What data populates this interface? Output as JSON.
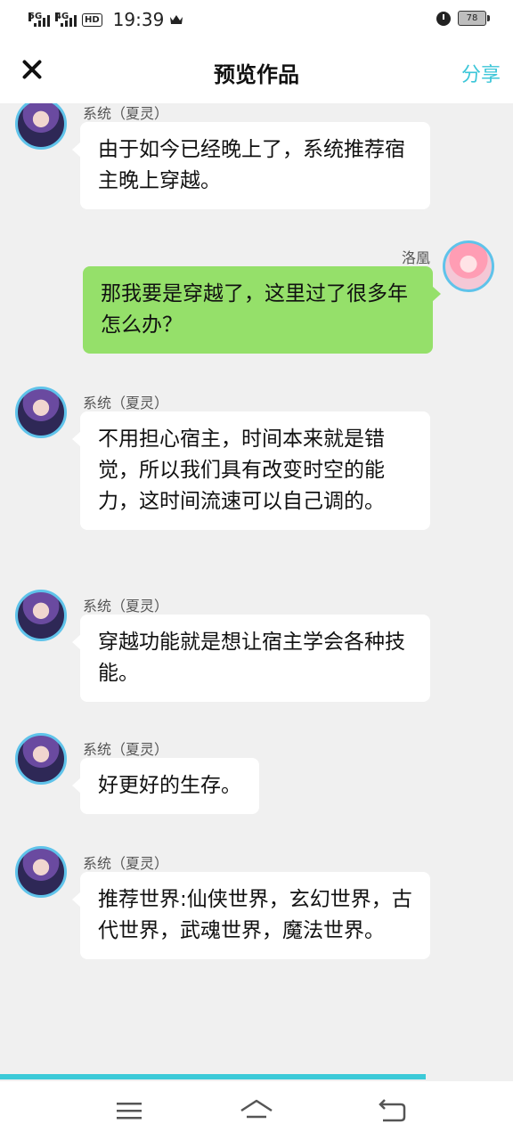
{
  "status_bar": {
    "signal1_label": "5G",
    "signal2_label": "4G",
    "hd_label": "HD",
    "time": "19:39",
    "battery": "78",
    "icons": [
      "crown-icon",
      "alarm-icon",
      "battery-icon"
    ]
  },
  "header": {
    "title": "预览作品",
    "share_label": "分享",
    "close_icon": "close-icon"
  },
  "messages": [
    {
      "side": "left",
      "name": "系统（夏灵）",
      "text": "由于如今已经晚上了，系统推荐宿主晚上穿越。"
    },
    {
      "side": "right",
      "name": "洛凰",
      "text": "那我要是穿越了，这里过了很多年怎么办？"
    },
    {
      "side": "left",
      "name": "系统（夏灵）",
      "text": "不用担心宿主，时间本来就是错觉，所以我们具有改变时空的能力，这时间流速可以自己调的。"
    },
    {
      "side": "left",
      "name": "系统（夏灵）",
      "text": "穿越功能就是想让宿主学会各种技能。"
    },
    {
      "side": "left",
      "name": "系统（夏灵）",
      "text": "好更好的生存。"
    },
    {
      "side": "left",
      "name": "系统（夏灵）",
      "text": "推荐世界:仙侠世界，玄幻世界，古代世界，武魂世界，魔法世界。"
    }
  ],
  "progress": {
    "fraction": 0.83
  },
  "colors": {
    "accent": "#3cc6d8",
    "user_bubble": "#95e06a",
    "background": "#f0f0f0"
  },
  "nav": {
    "icons": [
      "menu-icon",
      "home-icon",
      "back-icon"
    ]
  }
}
